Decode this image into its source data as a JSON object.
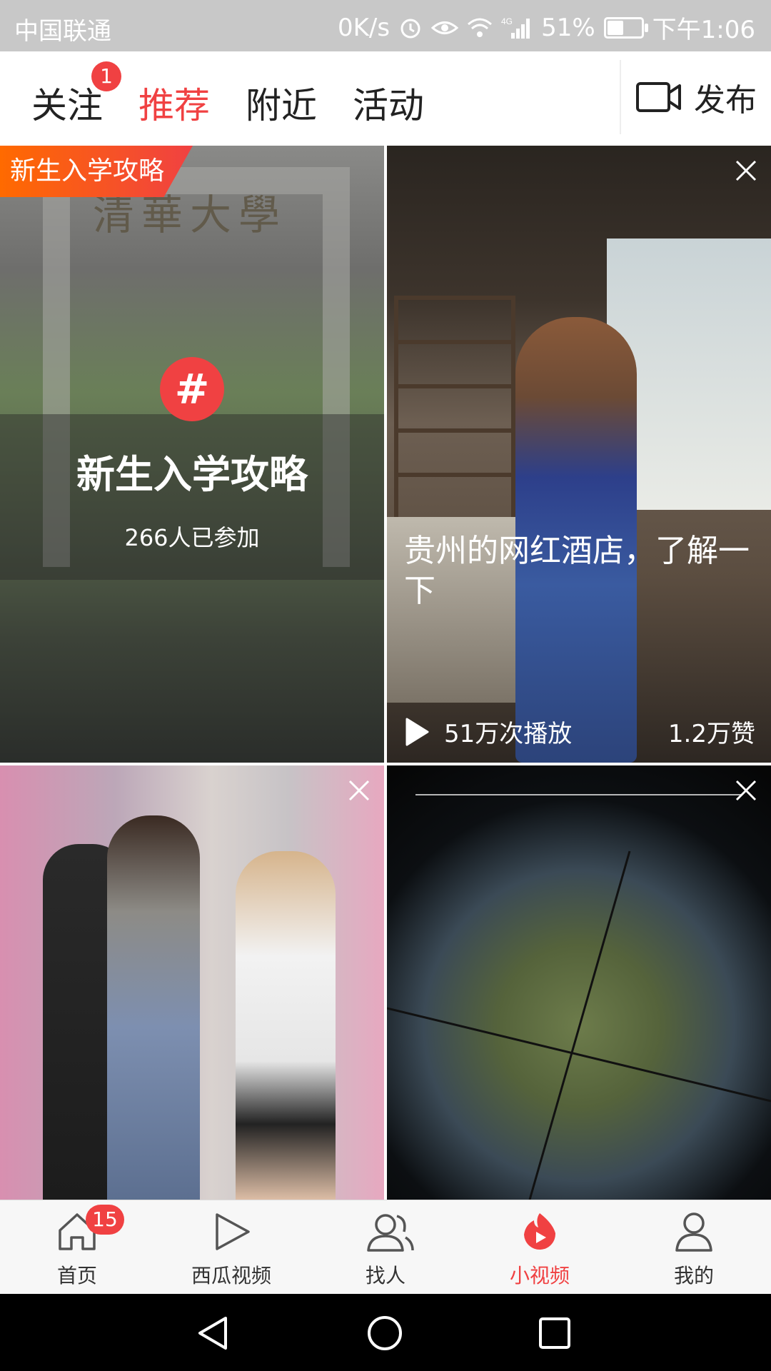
{
  "status_bar": {
    "carrier": "中国联通",
    "speed": "0K/s",
    "network": "4G",
    "battery": "51%",
    "battery_level": 0.51,
    "time": "下午1:06"
  },
  "top_tabs": {
    "items": [
      {
        "label": "关注",
        "badge": "1"
      },
      {
        "label": "推荐",
        "active": true
      },
      {
        "label": "附近"
      },
      {
        "label": "活动"
      }
    ],
    "publish_label": "发布"
  },
  "feed": {
    "card1": {
      "corner_tag": "新生入学攻略",
      "gate_text": "清華大學",
      "topic_icon": "#",
      "topic_title": "新生入学攻略",
      "participants": "266人已参加"
    },
    "card2": {
      "title": "贵州的网红酒店，了解一下",
      "plays": "51万次播放",
      "likes": "1.2万赞"
    },
    "card3": {},
    "card4": {}
  },
  "bottom_nav": {
    "items": [
      {
        "label": "首页",
        "badge": "15",
        "icon": "home-icon"
      },
      {
        "label": "西瓜视频",
        "icon": "play-icon"
      },
      {
        "label": "找人",
        "icon": "people-icon"
      },
      {
        "label": "小视频",
        "active": true,
        "icon": "short-video-icon"
      },
      {
        "label": "我的",
        "icon": "person-icon"
      }
    ]
  },
  "colors": {
    "accent": "#f04142",
    "status_bar": "#c8c8c8"
  }
}
